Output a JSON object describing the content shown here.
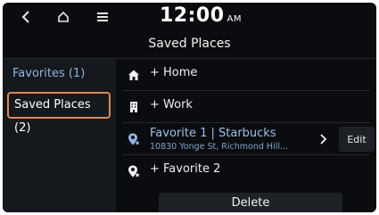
{
  "header": {
    "time": "12:00",
    "ampm": "AM",
    "title": "Saved Places"
  },
  "icons": {
    "back": "chevron-left-icon",
    "home": "home-icon",
    "menu": "menu-icon"
  },
  "sidebar": {
    "items": [
      {
        "label": "Favorites (1)",
        "selected": false
      },
      {
        "label": "Saved Places (2)",
        "selected": true
      }
    ]
  },
  "list": {
    "home": {
      "label": "+ Home"
    },
    "work": {
      "label": "+ Work"
    },
    "favorite1": {
      "title": "Favorite 1 | Starbucks",
      "address": "10830 Yonge St, Richmond Hill...",
      "edit_label": "Edit"
    },
    "favorite2": {
      "label": "+ Favorite 2"
    },
    "delete_label": "Delete"
  },
  "colors": {
    "background": "#0a0c0f",
    "sidebar_bg": "#15181c",
    "accent_blue": "#8fb6e2",
    "selection_border": "#d98a58"
  }
}
